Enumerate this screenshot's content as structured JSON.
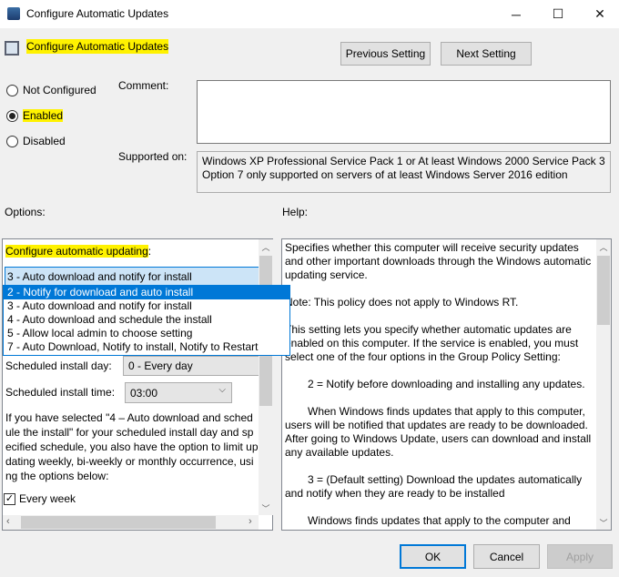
{
  "window": {
    "title": "Configure Automatic Updates",
    "minimize": "─",
    "maximize": "☐",
    "close": "✕"
  },
  "header": {
    "policy_name": "Configure Automatic Updates",
    "prev_button": "Previous Setting",
    "next_button": "Next Setting"
  },
  "state": {
    "options": [
      {
        "label": "Not Configured",
        "checked": false
      },
      {
        "label": "Enabled",
        "checked": true
      },
      {
        "label": "Disabled",
        "checked": false
      }
    ]
  },
  "comment": {
    "label": "Comment:",
    "value": ""
  },
  "supported": {
    "label": "Supported on:",
    "value": "Windows XP Professional Service Pack 1 or At least Windows 2000 Service Pack 3 Option 7 only supported on servers of at least Windows Server 2016 edition"
  },
  "options_label": "Options:",
  "help_label": "Help:",
  "options": {
    "configure_label": "Configure automatic updating",
    "configure_colon": ":",
    "selected": "3 - Auto download and notify for install",
    "dropdown_items": [
      "2 - Notify for download and auto install",
      "3 - Auto download and notify for install",
      "4 - Auto download and schedule the install",
      "5 - Allow local admin to choose setting",
      "7 - Auto Download, Notify to install, Notify to Restart"
    ],
    "highlighted_index": 0,
    "day_label": "Scheduled install day:",
    "day_value": "0 - Every day",
    "time_label": "Scheduled install time:",
    "time_value": "03:00",
    "paragraph": "If you have selected \"4 – Auto download and schedule the install\" for your scheduled install day and specified schedule, you also have the option to limit updating weekly, bi-weekly or monthly occurrence, using the options below:",
    "every_week_label": "Every week",
    "every_week_checked": true
  },
  "help": {
    "paragraphs": [
      "Specifies whether this computer will receive security updates and other important downloads through the Windows automatic updating service.",
      "Note: This policy does not apply to Windows RT.",
      "This setting lets you specify whether automatic updates are enabled on this computer. If the service is enabled, you must select one of the four options in the Group Policy Setting:",
      "2 = Notify before downloading and installing any updates.",
      "When Windows finds updates that apply to this computer, users will be notified that updates are ready to be downloaded. After going to Windows Update, users can download and install any available updates.",
      "3 = (Default setting) Download the updates automatically and notify when they are ready to be installed",
      "Windows finds updates that apply to the computer and downloads them in the background"
    ]
  },
  "footer": {
    "ok": "OK",
    "cancel": "Cancel",
    "apply": "Apply"
  }
}
